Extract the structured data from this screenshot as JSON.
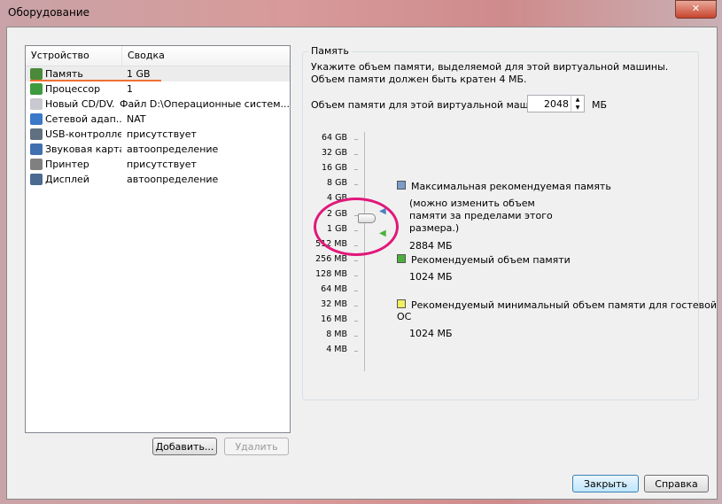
{
  "window": {
    "title": "Оборудование",
    "close": "✕"
  },
  "tree": {
    "headers": [
      "Устройство",
      "Сводка"
    ],
    "rows": [
      {
        "icon": "memory-icon",
        "color": "#4a8a3a",
        "device": "Память",
        "summary": "1 GB"
      },
      {
        "icon": "cpu-icon",
        "color": "#3e9a3e",
        "device": "Процессор",
        "summary": "1"
      },
      {
        "icon": "cd-icon",
        "color": "#c8c8d0",
        "device": "Новый CD/DV...",
        "summary": "Файл D:\\Операционные систем..."
      },
      {
        "icon": "network-icon",
        "color": "#3a78c8",
        "device": "Сетевой адап...",
        "summary": "NAT"
      },
      {
        "icon": "usb-icon",
        "color": "#607080",
        "device": "USB-контроллер",
        "summary": "присутствует"
      },
      {
        "icon": "sound-icon",
        "color": "#4070b0",
        "device": "Звуковая карта",
        "summary": "автоопределение"
      },
      {
        "icon": "printer-icon",
        "color": "#808080",
        "device": "Принтер",
        "summary": "присутствует"
      },
      {
        "icon": "display-icon",
        "color": "#4a6a90",
        "device": "Дисплей",
        "summary": "автоопределение"
      }
    ]
  },
  "buttons": {
    "add": "Добавить...",
    "remove": "Удалить",
    "close": "Закрыть",
    "help": "Справка"
  },
  "memory": {
    "group": "Память",
    "desc": "Укажите объем памяти, выделяемой для этой виртуальной машины. Объем памяти должен быть кратен 4 МБ.",
    "field_label": "Объем памяти для этой виртуальной машины:",
    "value": "2048",
    "unit": "МБ",
    "ticks": [
      "64 GB",
      "32 GB",
      "16 GB",
      "8 GB",
      "4 GB",
      "2 GB",
      "1 GB",
      "512 MB",
      "256 MB",
      "128 MB",
      "64 MB",
      "32 MB",
      "16 MB",
      "8 MB",
      "4 MB"
    ],
    "slider_value": "2 GB",
    "legend": [
      {
        "color": "#7b9cc8",
        "title": "Максимальная рекомендуемая память",
        "note": "(можно изменить объем памяти за пределами этого размера.)",
        "value": "2884 МБ"
      },
      {
        "color": "#4caf3c",
        "title": "Рекомендуемый объем памяти",
        "value": "1024 МБ"
      },
      {
        "color": "#f0f060",
        "title": "Рекомендуемый минимальный объем памяти для гостевой ОС",
        "value": "1024 МБ"
      }
    ]
  }
}
